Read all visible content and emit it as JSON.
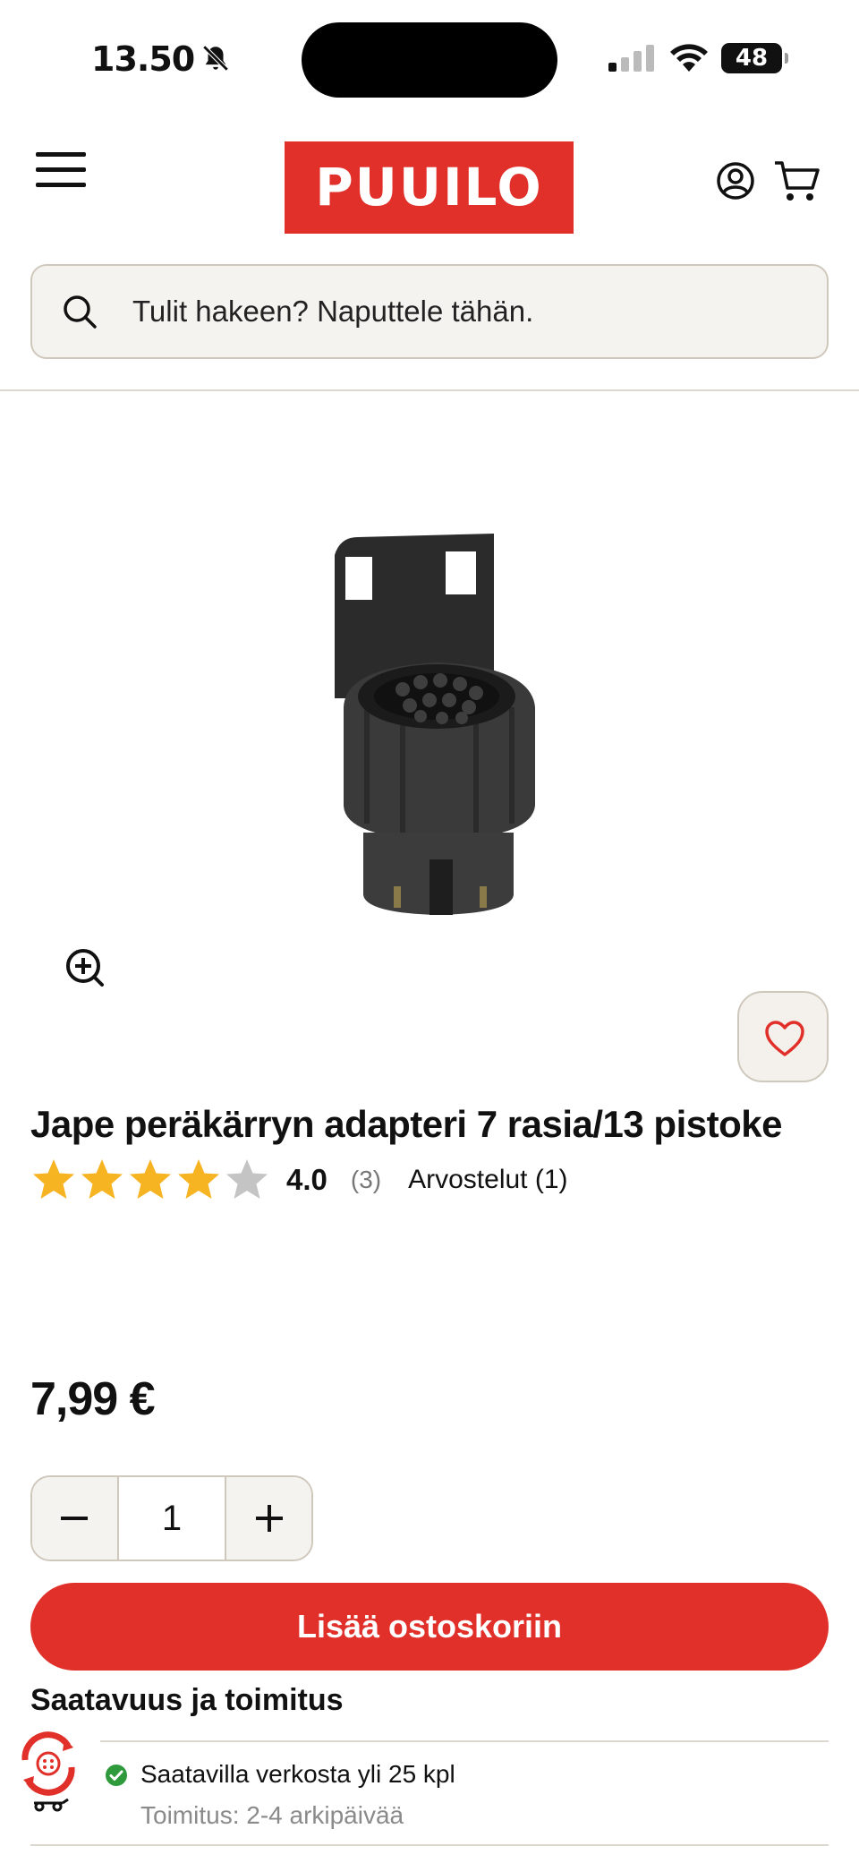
{
  "status_bar": {
    "time": "13.50",
    "battery": "48"
  },
  "header": {
    "logo_text": "PUUILO"
  },
  "search": {
    "placeholder": "Tulit hakeen? Naputtele tähän."
  },
  "product": {
    "title": "Jape peräkärryn adapteri 7 rasia/13 pistoke",
    "rating_value": "4.0",
    "rating_count": "(3)",
    "rating_stars": 4,
    "reviews_link": "Arvostelut (1)",
    "price": "7,99 €"
  },
  "purchase": {
    "quantity": "1",
    "add_to_cart": "Lisää ostoskoriin"
  },
  "availability": {
    "title": "Saatavuus ja toimitus",
    "stock": "Saatavilla verkosta yli 25 kpl",
    "delivery": "Toimitus: 2-4 arkipäivää"
  },
  "colors": {
    "brand_red": "#e1302a",
    "star_gold": "#f6b322",
    "star_empty": "#c4c4c4",
    "in_stock_green": "#2f9a3c"
  },
  "icons": [
    "bell-muted-icon",
    "signal-icon",
    "wifi-icon",
    "menu-icon",
    "account-icon",
    "cart-icon",
    "search-icon",
    "zoom-in-icon",
    "heart-icon",
    "minus-icon",
    "plus-icon",
    "check-circle-icon",
    "pickup-badge-icon"
  ]
}
